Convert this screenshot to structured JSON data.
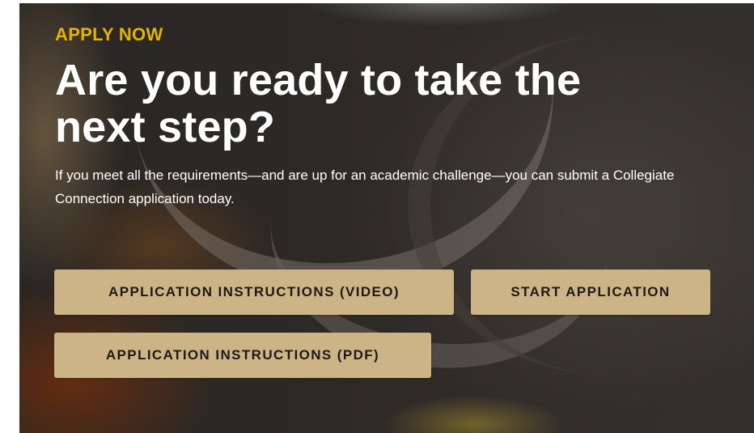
{
  "hero": {
    "eyebrow": "APPLY NOW",
    "headline": "Are you ready to take the next step?",
    "body": "If you meet all the requirements—and are up for an academic challenge—you can submit a Collegiate Connection application today.",
    "colors": {
      "eyebrow": "#e8b300",
      "button_bg": "#cdb487",
      "button_text": "#1c1a17"
    }
  },
  "actions": {
    "video_label": "APPLICATION INSTRUCTIONS (VIDEO)",
    "start_label": "START APPLICATION",
    "pdf_label": "APPLICATION INSTRUCTIONS (PDF)"
  }
}
